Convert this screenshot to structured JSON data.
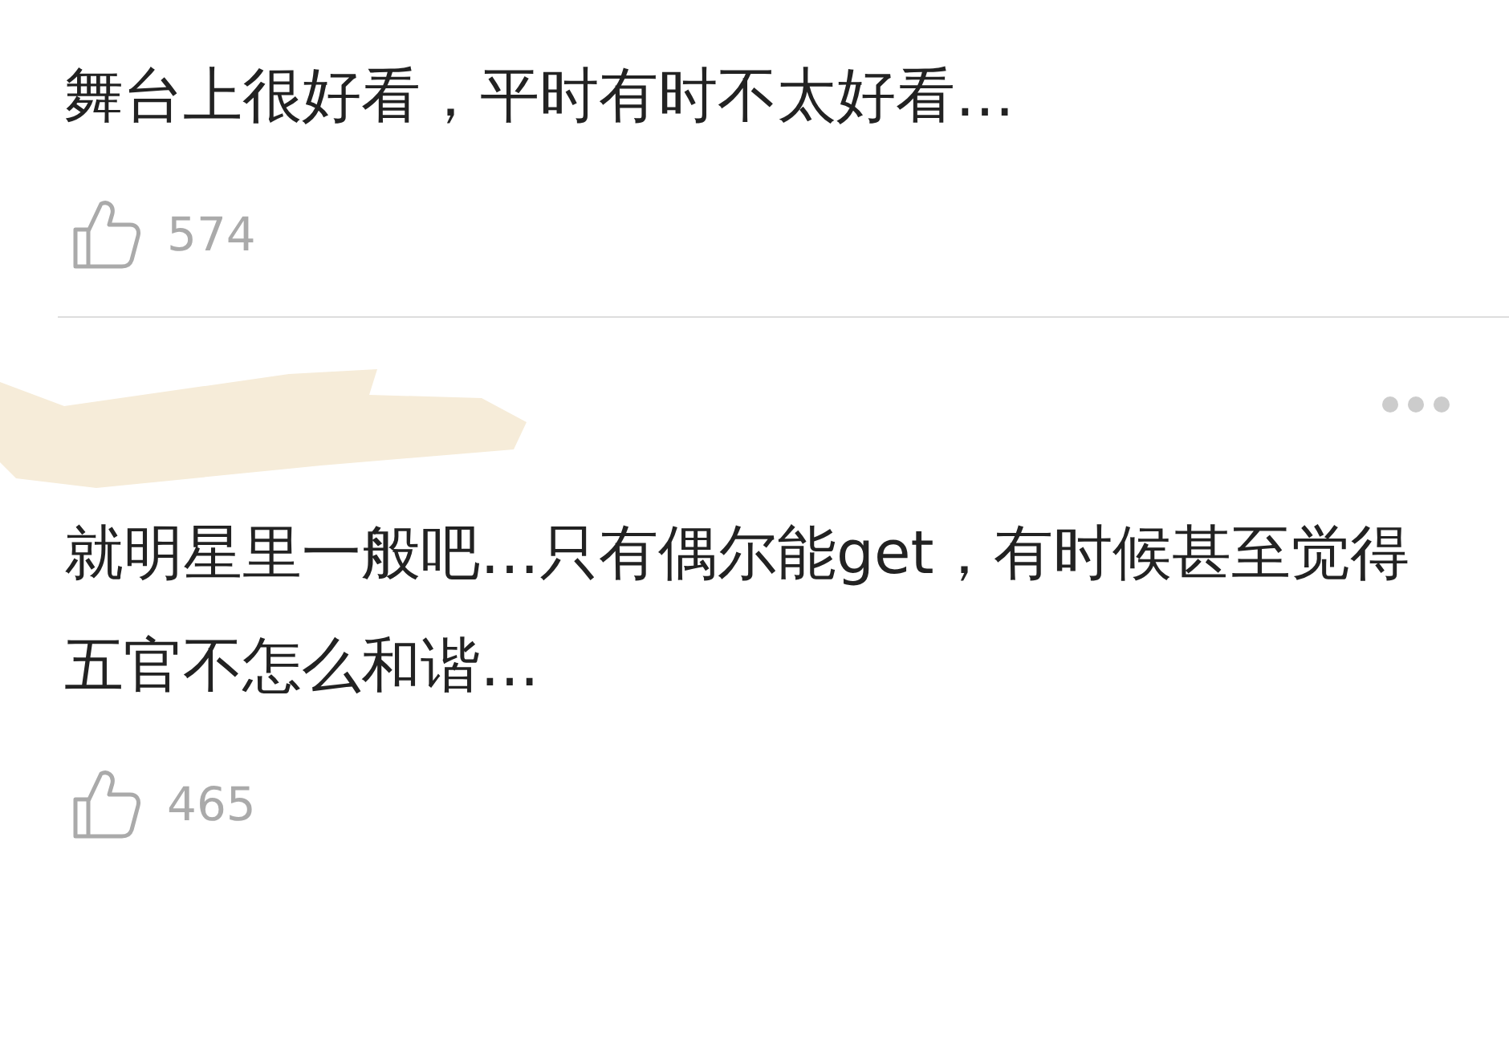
{
  "comments": [
    {
      "kind": "continued",
      "text": "舞台上很好看，平时有时不太好看…",
      "likes": "574"
    },
    {
      "kind": "full",
      "text": "就明星里一般吧…只有偶尔能get，有时候甚至觉得五官不怎么和谐…",
      "likes": "465"
    }
  ]
}
